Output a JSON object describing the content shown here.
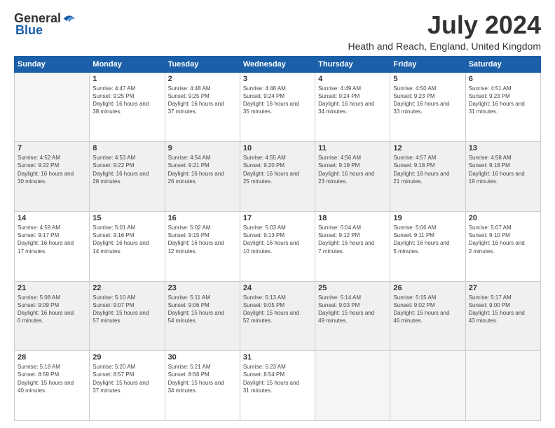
{
  "logo": {
    "general": "General",
    "blue": "Blue"
  },
  "title": "July 2024",
  "location": "Heath and Reach, England, United Kingdom",
  "days_header": [
    "Sunday",
    "Monday",
    "Tuesday",
    "Wednesday",
    "Thursday",
    "Friday",
    "Saturday"
  ],
  "weeks": [
    [
      {
        "day": "",
        "sunrise": "",
        "sunset": "",
        "daylight": ""
      },
      {
        "day": "1",
        "sunrise": "Sunrise: 4:47 AM",
        "sunset": "Sunset: 9:25 PM",
        "daylight": "Daylight: 16 hours and 38 minutes."
      },
      {
        "day": "2",
        "sunrise": "Sunrise: 4:48 AM",
        "sunset": "Sunset: 9:25 PM",
        "daylight": "Daylight: 16 hours and 37 minutes."
      },
      {
        "day": "3",
        "sunrise": "Sunrise: 4:48 AM",
        "sunset": "Sunset: 9:24 PM",
        "daylight": "Daylight: 16 hours and 35 minutes."
      },
      {
        "day": "4",
        "sunrise": "Sunrise: 4:49 AM",
        "sunset": "Sunset: 9:24 PM",
        "daylight": "Daylight: 16 hours and 34 minutes."
      },
      {
        "day": "5",
        "sunrise": "Sunrise: 4:50 AM",
        "sunset": "Sunset: 9:23 PM",
        "daylight": "Daylight: 16 hours and 33 minutes."
      },
      {
        "day": "6",
        "sunrise": "Sunrise: 4:51 AM",
        "sunset": "Sunset: 9:23 PM",
        "daylight": "Daylight: 16 hours and 31 minutes."
      }
    ],
    [
      {
        "day": "7",
        "sunrise": "Sunrise: 4:52 AM",
        "sunset": "Sunset: 9:22 PM",
        "daylight": "Daylight: 16 hours and 30 minutes."
      },
      {
        "day": "8",
        "sunrise": "Sunrise: 4:53 AM",
        "sunset": "Sunset: 9:22 PM",
        "daylight": "Daylight: 16 hours and 28 minutes."
      },
      {
        "day": "9",
        "sunrise": "Sunrise: 4:54 AM",
        "sunset": "Sunset: 9:21 PM",
        "daylight": "Daylight: 16 hours and 26 minutes."
      },
      {
        "day": "10",
        "sunrise": "Sunrise: 4:55 AM",
        "sunset": "Sunset: 9:20 PM",
        "daylight": "Daylight: 16 hours and 25 minutes."
      },
      {
        "day": "11",
        "sunrise": "Sunrise: 4:56 AM",
        "sunset": "Sunset: 9:19 PM",
        "daylight": "Daylight: 16 hours and 23 minutes."
      },
      {
        "day": "12",
        "sunrise": "Sunrise: 4:57 AM",
        "sunset": "Sunset: 9:18 PM",
        "daylight": "Daylight: 16 hours and 21 minutes."
      },
      {
        "day": "13",
        "sunrise": "Sunrise: 4:58 AM",
        "sunset": "Sunset: 9:18 PM",
        "daylight": "Daylight: 16 hours and 19 minutes."
      }
    ],
    [
      {
        "day": "14",
        "sunrise": "Sunrise: 4:59 AM",
        "sunset": "Sunset: 9:17 PM",
        "daylight": "Daylight: 16 hours and 17 minutes."
      },
      {
        "day": "15",
        "sunrise": "Sunrise: 5:01 AM",
        "sunset": "Sunset: 9:16 PM",
        "daylight": "Daylight: 16 hours and 14 minutes."
      },
      {
        "day": "16",
        "sunrise": "Sunrise: 5:02 AM",
        "sunset": "Sunset: 9:15 PM",
        "daylight": "Daylight: 16 hours and 12 minutes."
      },
      {
        "day": "17",
        "sunrise": "Sunrise: 5:03 AM",
        "sunset": "Sunset: 9:13 PM",
        "daylight": "Daylight: 16 hours and 10 minutes."
      },
      {
        "day": "18",
        "sunrise": "Sunrise: 5:04 AM",
        "sunset": "Sunset: 9:12 PM",
        "daylight": "Daylight: 16 hours and 7 minutes."
      },
      {
        "day": "19",
        "sunrise": "Sunrise: 5:06 AM",
        "sunset": "Sunset: 9:11 PM",
        "daylight": "Daylight: 16 hours and 5 minutes."
      },
      {
        "day": "20",
        "sunrise": "Sunrise: 5:07 AM",
        "sunset": "Sunset: 9:10 PM",
        "daylight": "Daylight: 16 hours and 2 minutes."
      }
    ],
    [
      {
        "day": "21",
        "sunrise": "Sunrise: 5:08 AM",
        "sunset": "Sunset: 9:09 PM",
        "daylight": "Daylight: 16 hours and 0 minutes."
      },
      {
        "day": "22",
        "sunrise": "Sunrise: 5:10 AM",
        "sunset": "Sunset: 9:07 PM",
        "daylight": "Daylight: 15 hours and 57 minutes."
      },
      {
        "day": "23",
        "sunrise": "Sunrise: 5:11 AM",
        "sunset": "Sunset: 9:06 PM",
        "daylight": "Daylight: 15 hours and 54 minutes."
      },
      {
        "day": "24",
        "sunrise": "Sunrise: 5:13 AM",
        "sunset": "Sunset: 9:05 PM",
        "daylight": "Daylight: 15 hours and 52 minutes."
      },
      {
        "day": "25",
        "sunrise": "Sunrise: 5:14 AM",
        "sunset": "Sunset: 9:03 PM",
        "daylight": "Daylight: 15 hours and 49 minutes."
      },
      {
        "day": "26",
        "sunrise": "Sunrise: 5:15 AM",
        "sunset": "Sunset: 9:02 PM",
        "daylight": "Daylight: 15 hours and 46 minutes."
      },
      {
        "day": "27",
        "sunrise": "Sunrise: 5:17 AM",
        "sunset": "Sunset: 9:00 PM",
        "daylight": "Daylight: 15 hours and 43 minutes."
      }
    ],
    [
      {
        "day": "28",
        "sunrise": "Sunrise: 5:18 AM",
        "sunset": "Sunset: 8:59 PM",
        "daylight": "Daylight: 15 hours and 40 minutes."
      },
      {
        "day": "29",
        "sunrise": "Sunrise: 5:20 AM",
        "sunset": "Sunset: 8:57 PM",
        "daylight": "Daylight: 15 hours and 37 minutes."
      },
      {
        "day": "30",
        "sunrise": "Sunrise: 5:21 AM",
        "sunset": "Sunset: 8:56 PM",
        "daylight": "Daylight: 15 hours and 34 minutes."
      },
      {
        "day": "31",
        "sunrise": "Sunrise: 5:23 AM",
        "sunset": "Sunset: 8:54 PM",
        "daylight": "Daylight: 15 hours and 31 minutes."
      },
      {
        "day": "",
        "sunrise": "",
        "sunset": "",
        "daylight": ""
      },
      {
        "day": "",
        "sunrise": "",
        "sunset": "",
        "daylight": ""
      },
      {
        "day": "",
        "sunrise": "",
        "sunset": "",
        "daylight": ""
      }
    ]
  ]
}
